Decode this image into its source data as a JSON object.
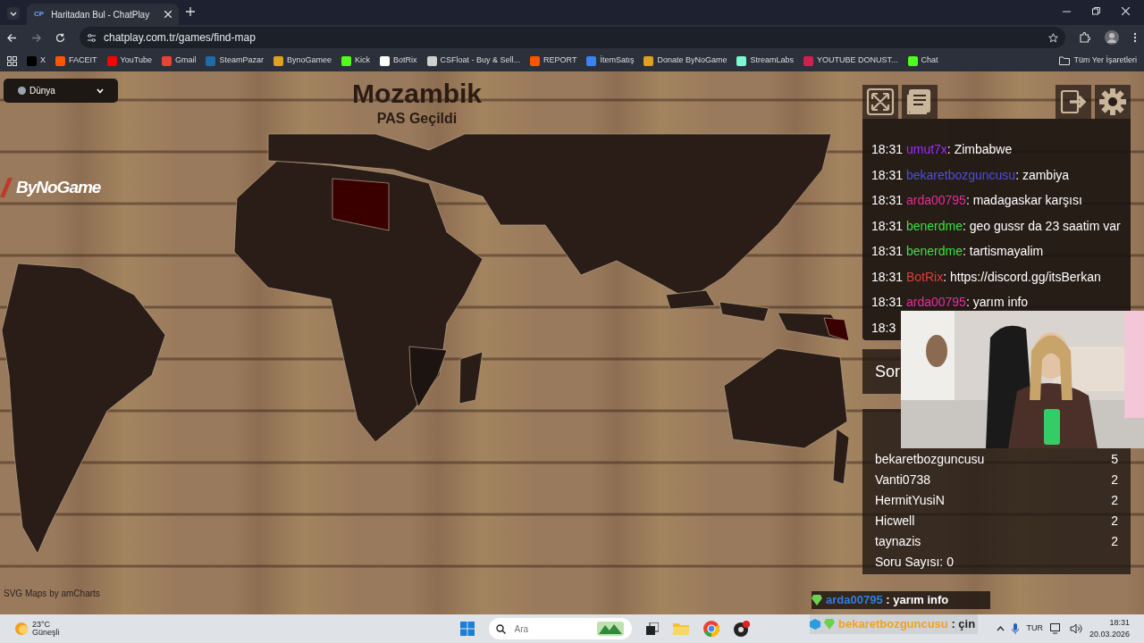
{
  "browser": {
    "tab_title": "Haritadan Bul - ChatPlay",
    "tab_favicon": "CP",
    "url": "chatplay.com.tr/games/find-map",
    "bookmarks": [
      {
        "label": "X",
        "color": "#000000"
      },
      {
        "label": "FACEIT",
        "color": "#ff5500"
      },
      {
        "label": "YouTube",
        "color": "#ff0000"
      },
      {
        "label": "Gmail",
        "color": "#ea4335"
      },
      {
        "label": "SteamPazar",
        "color": "#1b6ca8"
      },
      {
        "label": "BynoGamee",
        "color": "#e0a020"
      },
      {
        "label": "Kick",
        "color": "#53fc18"
      },
      {
        "label": "BotRix",
        "color": "#ffffff"
      },
      {
        "label": "CSFloat - Buy & Sell...",
        "color": "#cfcfcf"
      },
      {
        "label": "REPORT",
        "color": "#ff5500"
      },
      {
        "label": "İtemSatış",
        "color": "#3b82f6"
      },
      {
        "label": "Donate ByNoGame",
        "color": "#e0a020"
      },
      {
        "label": "StreamLabs",
        "color": "#80f5d2"
      },
      {
        "label": "YOUTUBE DONUST...",
        "color": "#d0204f"
      },
      {
        "label": "Chat",
        "color": "#53fc18"
      }
    ],
    "all_bookmarks": "Tüm Yer İşaretleri"
  },
  "game": {
    "region_select": "Dünya",
    "country": "Mozambik",
    "status": "PAS Geçildi",
    "logo": "ByNoGame",
    "credit": "SVG Maps by amCharts"
  },
  "chat": {
    "messages": [
      {
        "time": "18:31",
        "user": "umut7x",
        "color": "#9b30ff",
        "text": ": Zimbabwe"
      },
      {
        "time": "18:31",
        "user": "bekaretbozguncusu",
        "color": "#4a50e0",
        "text": ": zambiya"
      },
      {
        "time": "18:31",
        "user": "arda00795",
        "color": "#e0309a",
        "text": ": madagaskar karşısı"
      },
      {
        "time": "18:31",
        "user": "benerdme",
        "color": "#3ee03e",
        "text": ": geo gussr da 23 saatim var"
      },
      {
        "time": "18:31",
        "user": "benerdme",
        "color": "#3ee03e",
        "text": ": tartismayalim"
      },
      {
        "time": "18:31",
        "user": "BotRix",
        "color": "#e03c3c",
        "text": ": https://discord.gg/itsBerkan"
      },
      {
        "time": "18:31",
        "user": "arda00795",
        "color": "#e0309a",
        "text": ": yarım info"
      }
    ],
    "cut_line": "18:3"
  },
  "question_box": {
    "label": "Sor"
  },
  "leaderboard": {
    "rows": [
      {
        "name": "bekaretbozguncusu",
        "score": "5"
      },
      {
        "name": "Vanti0738",
        "score": "2"
      },
      {
        "name": "HermitYusiN",
        "score": "2"
      },
      {
        "name": "Hicwell",
        "score": "2"
      },
      {
        "name": "taynazis",
        "score": "2"
      }
    ],
    "question_count": "Soru Sayısı: 0"
  },
  "stream_alerts": [
    {
      "kind": "standard",
      "user": "arda00795",
      "color": "#2e7fe0",
      "text": ": yarım info"
    },
    {
      "kind": "subscriber",
      "user": "bekaretbozguncusu",
      "color": "#f0a020",
      "text": ": çin"
    }
  ],
  "taskbar": {
    "temperature": "23°C",
    "weather": "Güneşli",
    "search_placeholder": "Ara",
    "language": "TUR",
    "time": "18:31",
    "date": "20.03.2026"
  }
}
